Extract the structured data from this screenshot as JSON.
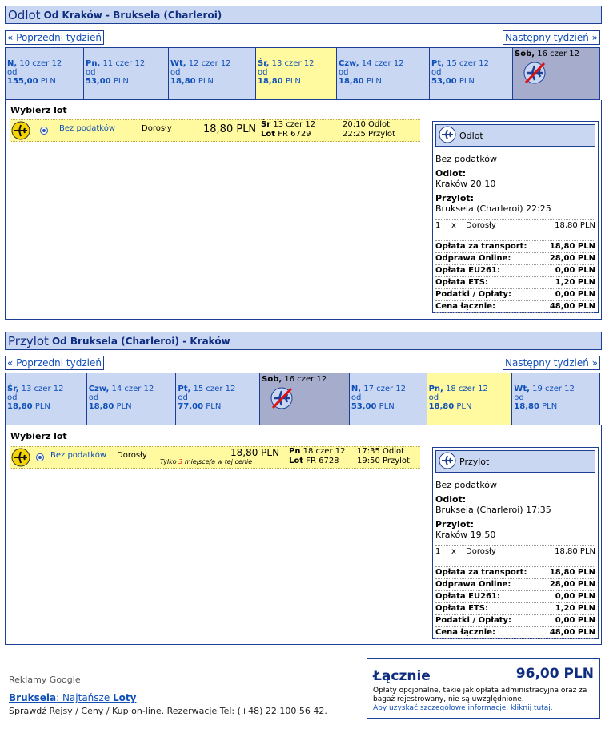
{
  "outbound": {
    "head_word": "Odlot",
    "route": "Od Kraków - Bruksela (Charleroi)",
    "prev_week": "« Poprzedni tydzień",
    "next_week": "Następny tydzień »",
    "days": [
      {
        "name": "N,",
        "date": "10 czer 12",
        "od": "od",
        "price": "155,00",
        "currency": "PLN",
        "state": "normal"
      },
      {
        "name": "Pn,",
        "date": "11 czer 12",
        "od": "od",
        "price": "53,00",
        "currency": "PLN",
        "state": "normal"
      },
      {
        "name": "Wt,",
        "date": "12 czer 12",
        "od": "od",
        "price": "18,80",
        "currency": "PLN",
        "state": "normal"
      },
      {
        "name": "Śr,",
        "date": "13 czer 12",
        "od": "od",
        "price": "18,80",
        "currency": "PLN",
        "state": "selected"
      },
      {
        "name": "Czw,",
        "date": "14 czer 12",
        "od": "od",
        "price": "18,80",
        "currency": "PLN",
        "state": "normal"
      },
      {
        "name": "Pt,",
        "date": "15 czer 12",
        "od": "od",
        "price": "53,00",
        "currency": "PLN",
        "state": "normal"
      },
      {
        "name": "Sob,",
        "date": "16 czer 12",
        "state": "unavailable"
      }
    ],
    "choose": "Wybierz lot",
    "flight": {
      "fare": "Bez podatków",
      "pax": "Dorosły",
      "price": "18,80 PLN",
      "day": "Śr",
      "date": "13 czer 12",
      "lot": "Lot",
      "flight_no": "FR 6729",
      "dep_time": "20:10",
      "dep_label": "Odlot",
      "arr_time": "22:25",
      "arr_label": "Przylot"
    },
    "summary": {
      "title": "Odlot",
      "fare": "Bez podatków",
      "dep_label": "Odlot:",
      "dep_value": "Kraków 20:10",
      "arr_label": "Przylot:",
      "arr_value": "Bruksela (Charleroi) 22:25",
      "pax_count": "1",
      "pax_x": "x",
      "pax_type": "Dorosły",
      "pax_price": "18,80 PLN",
      "fees": [
        {
          "label": "Opłata za transport:",
          "value": "18,80 PLN"
        },
        {
          "label": "Odprawa Online:",
          "value": "28,00 PLN"
        },
        {
          "label": "Opłata EU261:",
          "value": "0,00 PLN"
        },
        {
          "label": "Opłata ETS:",
          "value": "1,20 PLN"
        },
        {
          "label": "Podatki / Opłaty:",
          "value": "0,00 PLN"
        },
        {
          "label": "Cena łącznie:",
          "value": "48,00 PLN"
        }
      ]
    }
  },
  "inbound": {
    "head_word": "Przylot",
    "route": "Od Bruksela (Charleroi) - Kraków",
    "prev_week": "« Poprzedni tydzień",
    "next_week": "Następny tydzień »",
    "days": [
      {
        "name": "Śr,",
        "date": "13 czer 12",
        "od": "od",
        "price": "18,80",
        "currency": "PLN",
        "state": "normal"
      },
      {
        "name": "Czw,",
        "date": "14 czer 12",
        "od": "od",
        "price": "18,80",
        "currency": "PLN",
        "state": "normal"
      },
      {
        "name": "Pt,",
        "date": "15 czer 12",
        "od": "od",
        "price": "77,00",
        "currency": "PLN",
        "state": "normal"
      },
      {
        "name": "Sob,",
        "date": "16 czer 12",
        "state": "unavailable"
      },
      {
        "name": "N,",
        "date": "17 czer 12",
        "od": "od",
        "price": "53,00",
        "currency": "PLN",
        "state": "normal"
      },
      {
        "name": "Pn,",
        "date": "18 czer 12",
        "od": "od",
        "price": "18,80",
        "currency": "PLN",
        "state": "selected"
      },
      {
        "name": "Wt,",
        "date": "19 czer 12",
        "od": "od",
        "price": "18,80",
        "currency": "PLN",
        "state": "normal"
      }
    ],
    "choose": "Wybierz lot",
    "flight": {
      "fare": "Bez podatków",
      "pax": "Dorosły",
      "price": "18,80 PLN",
      "seats_pre": "Tylko",
      "seats_num": "3",
      "seats_post": "miejsce/a w tej cenie",
      "day": "Pn",
      "date": "18 czer 12",
      "lot": "Lot",
      "flight_no": "FR 6728",
      "dep_time": "17:35",
      "dep_label": "Odlot",
      "arr_time": "19:50",
      "arr_label": "Przylot"
    },
    "summary": {
      "title": "Przylot",
      "fare": "Bez podatków",
      "dep_label": "Odlot:",
      "dep_value": "Bruksela (Charleroi) 17:35",
      "arr_label": "Przylot:",
      "arr_value": "Kraków 19:50",
      "pax_count": "1",
      "pax_x": "x",
      "pax_type": "Dorosły",
      "pax_price": "18,80 PLN",
      "fees": [
        {
          "label": "Opłata za transport:",
          "value": "18,80 PLN"
        },
        {
          "label": "Odprawa Online:",
          "value": "28,00 PLN"
        },
        {
          "label": "Opłata EU261:",
          "value": "0,00 PLN"
        },
        {
          "label": "Opłata ETS:",
          "value": "1,20 PLN"
        },
        {
          "label": "Podatki / Opłaty:",
          "value": "0,00 PLN"
        },
        {
          "label": "Cena łącznie:",
          "value": "48,00 PLN"
        }
      ]
    }
  },
  "ads": {
    "title": "Reklamy Google",
    "link_a": "Bruksela",
    "link_sep": ": Najtańsze ",
    "link_b": "Loty",
    "text": "Sprawdź Rejsy / Ceny / Kup on-line. Rezerwacje Tel: (+48) 22 100 56 42."
  },
  "total": {
    "label": "Łącznie",
    "value": "96,00 PLN",
    "note": "Opłaty opcjonalne, takie jak opłata administracyjna oraz za bagaż rejestrowany, nie są uwzględnione.",
    "link": "Aby uzyskać szczegółowe informacje, kliknij tutaj."
  },
  "colors": {
    "header_bg": "#cad7f3",
    "border": "#1c3f94",
    "selected": "#fffaa0",
    "unavailable": "#a5accc",
    "link": "#0f4fb8"
  }
}
